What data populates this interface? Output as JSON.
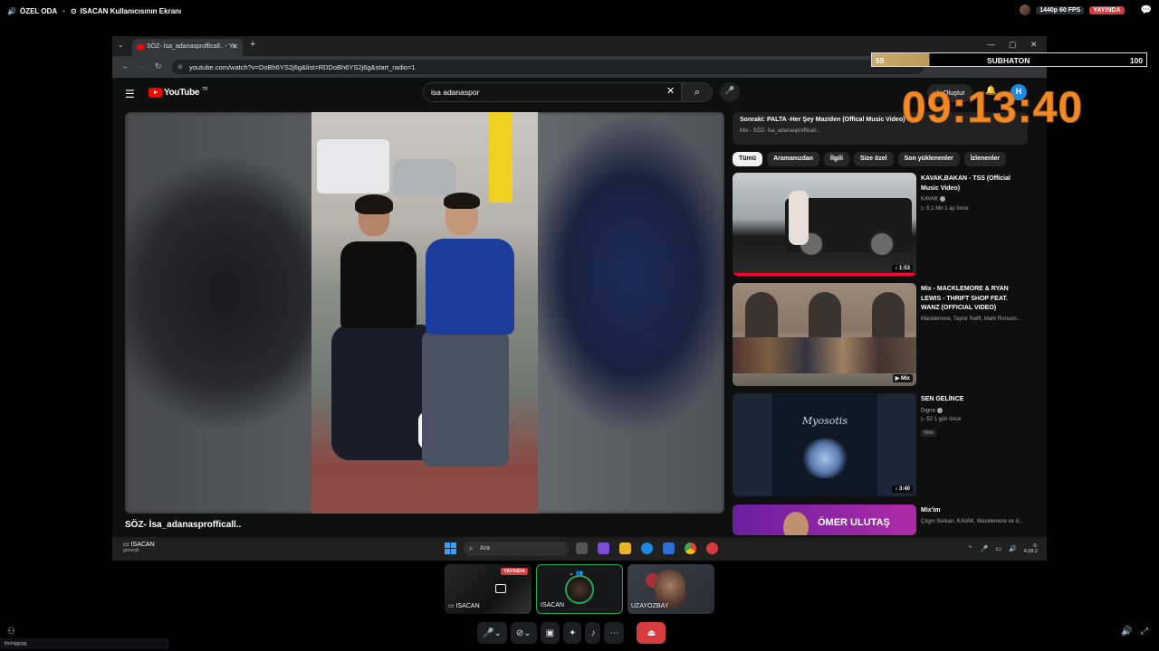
{
  "topbar": {
    "channel": "ÖZEL ODA",
    "stream_title": "ISACAN Kullanıcısının Ekranı",
    "quality": "1440p 60 FPS",
    "live": "YAYINDA"
  },
  "browser": {
    "tab_title": "SÖZ- İsa_adanasprofficall.. - Yo",
    "url": "youtube.com/watch?v=DoBh6YS2j6g&list=RDDoBh6YS2j6g&start_radio=1"
  },
  "youtube": {
    "logo": "YouTube",
    "region": "TR",
    "search_value": "isa adanaspor",
    "create_label": "Oluştur",
    "avatar_letter": "H",
    "video_title": "SÖZ- İsa_adanasprofficall..",
    "up_next": {
      "title": "Sonraki: PALTA -Her Şey Maziden (Offical Music Video)",
      "sub": "Mix - SÖZ- İsa_adanasprofficall..."
    },
    "chips": [
      "Tümü",
      "Aramanızdan",
      "İlgili",
      "Size özel",
      "Son yüklenenler",
      "İzlenenler"
    ],
    "recs": [
      {
        "title": "KAVAK,BAKAN - TSS (Official Music Video)",
        "channel": "KAVAK",
        "meta": "▷ 5,1 Mn  1 ay önce",
        "duration": "♪ 1:53"
      },
      {
        "title": "Mix - MACKLEMORE & RYAN LEWIS - THRIFT SHOP FEAT. WANZ (OFFICIAL VIDEO)",
        "channel": "Macklemore, Taylor Swift, Mark Ronson...",
        "meta": "",
        "duration": "▶ Mix"
      },
      {
        "title": "SEN GELİNCE",
        "channel": "Digna",
        "meta": "▷ 52  1 gün önce",
        "badge": "Yeni",
        "duration": "♪ 3:40",
        "cover_text": "Myosotis"
      },
      {
        "title": "Mix'im",
        "channel": "Çılgın Serkan, KAVAK, Macklemore ve d...",
        "meta": "",
        "thumb_text": "ÖMER ULUTAŞ"
      }
    ]
  },
  "taskbar": {
    "user": "ISACAN",
    "weather": "güneşli",
    "search_placeholder": "Ara",
    "time": "0:",
    "date": "4.08.2"
  },
  "overlay": {
    "subathon_left": "55",
    "subathon_label": "SUBHATON",
    "subathon_right": "100",
    "subathon_progress": 0.21,
    "timer": "09:13:40"
  },
  "participants": [
    {
      "name": "ISACAN",
      "live": "YAYINDA"
    },
    {
      "name": "ISACAN"
    },
    {
      "name": "UZAYOZBAY"
    }
  ],
  "bottom": {
    "user_strip": "thebiggygg"
  },
  "colors": {
    "accent_live": "#d83c3e",
    "youtube_red": "#ff0000",
    "timer": "#f08a24",
    "speaking": "#23a55a"
  }
}
